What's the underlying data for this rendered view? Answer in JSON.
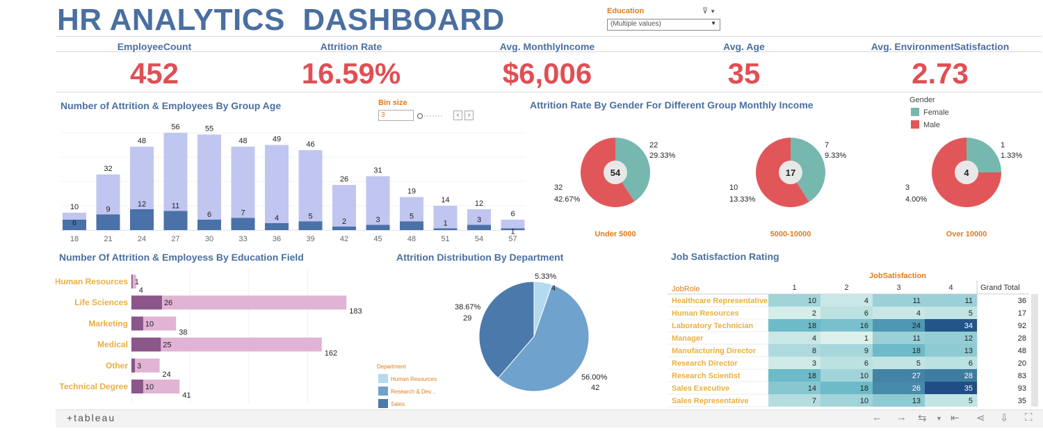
{
  "title": "HR ANALYTICS  DASHBOARD",
  "filter": {
    "label": "Education",
    "value": "(Multiple values)",
    "clear_icon": "filter-clear-icon",
    "dropdown_icon": "chevron-down-icon"
  },
  "kpis": [
    {
      "label": "EmployeeCount",
      "value": "452"
    },
    {
      "label": "Attrition Rate",
      "value": "16.59%"
    },
    {
      "label": "Avg. MonthlyIncome",
      "value": "$6,006"
    },
    {
      "label": "Avg. Age",
      "value": "35"
    },
    {
      "label": "Avg. EnvironmentSatisfaction",
      "value": "2.73"
    }
  ],
  "age_chart": {
    "title": "Number of Attrition & Employees By Group Age",
    "bin_label": "Bin size",
    "bin_value": "3"
  },
  "gender_chart": {
    "title": "Attrition Rate By Gender For Different Group Monthly Income",
    "legend_title": "Gender",
    "legend": [
      "Female",
      "Male"
    ]
  },
  "edu_chart": {
    "title": "Number Of Attrition & Employess By Education Field"
  },
  "dept_chart": {
    "title": "Attrition Distribution By Department",
    "legend_title": "Department",
    "legend": [
      "Human Resources",
      "Research & Dev...",
      "Sales"
    ]
  },
  "job_chart": {
    "title": "Job Satisfaction Rating"
  },
  "colors": {
    "title_blue": "#4a6fa0",
    "kpi_red": "#e04f55",
    "orange": "#e07b1a",
    "bar_light": "#c0c6f0",
    "bar_dark": "#4a71a8",
    "female": "#76b7b0",
    "male": "#e15759",
    "edu_light": "#e1b3d4",
    "edu_dark": "#8b568a",
    "dept_hr": "#b5daf0",
    "dept_rd": "#6fa2cc",
    "dept_sales": "#4b79ab"
  },
  "chart_data": [
    {
      "type": "bar",
      "categories": [
        "18",
        "21",
        "24",
        "27",
        "30",
        "33",
        "36",
        "39",
        "42",
        "45",
        "48",
        "51",
        "54",
        "57"
      ],
      "series": [
        {
          "values": [
            10,
            32,
            48,
            56,
            55,
            48,
            49,
            46,
            26,
            31,
            19,
            14,
            12,
            6
          ]
        },
        {
          "values": [
            6,
            9,
            12,
            11,
            6,
            7,
            4,
            5,
            2,
            3,
            5,
            1,
            3,
            1
          ]
        }
      ]
    },
    {
      "type": "pie",
      "groups": [
        {
          "label": "Under 5000",
          "total": 54,
          "female": {
            "count": 22,
            "pct": "29.33%"
          },
          "male": {
            "count": 32,
            "pct": "42.67%"
          }
        },
        {
          "label": "5000-10000",
          "total": 17,
          "female": {
            "count": 7,
            "pct": "9.33%"
          },
          "male": {
            "count": 10,
            "pct": "13.33%"
          }
        },
        {
          "label": "Over 10000",
          "total": 4,
          "female": {
            "count": 1,
            "pct": "1.33%"
          },
          "male": {
            "count": 3,
            "pct": "4.00%"
          }
        }
      ]
    },
    {
      "type": "bar",
      "categories": [
        "Human Resources",
        "Life Sciences",
        "Marketing",
        "Medical",
        "Other",
        "Technical Degree"
      ],
      "series": [
        {
          "values": [
            4,
            183,
            38,
            162,
            24,
            41
          ]
        },
        {
          "values": [
            1,
            26,
            10,
            25,
            3,
            10
          ]
        }
      ]
    },
    {
      "type": "pie",
      "slices": [
        {
          "label": "Human Resources",
          "count": 4,
          "pct": "5.33%"
        },
        {
          "label": "Research & Dev...",
          "count": 42,
          "pct": "56.00%"
        },
        {
          "label": "Sales",
          "count": 29,
          "pct": "38.67%"
        }
      ]
    },
    {
      "type": "heatmap",
      "column_header": "JobSatisfaction",
      "row_header": "JobRole",
      "columns": [
        "1",
        "2",
        "3",
        "4"
      ],
      "total_label": "Grand Total",
      "rows": [
        {
          "role": "Healthcare Representative",
          "values": [
            10,
            4,
            11,
            11
          ],
          "total": 36
        },
        {
          "role": "Human Resources",
          "values": [
            2,
            6,
            4,
            5
          ],
          "total": 17
        },
        {
          "role": "Laboratory Technician",
          "values": [
            18,
            16,
            24,
            34
          ],
          "total": 92
        },
        {
          "role": "Manager",
          "values": [
            4,
            1,
            11,
            12
          ],
          "total": 28
        },
        {
          "role": "Manufacturing Director",
          "values": [
            8,
            9,
            18,
            13
          ],
          "total": 48
        },
        {
          "role": "Research Director",
          "values": [
            3,
            6,
            5,
            6
          ],
          "total": 20
        },
        {
          "role": "Research Scientist",
          "values": [
            18,
            10,
            27,
            28
          ],
          "total": 83
        },
        {
          "role": "Sales Executive",
          "values": [
            14,
            18,
            26,
            35
          ],
          "total": 93
        },
        {
          "role": "Sales Representative",
          "values": [
            7,
            10,
            13,
            5
          ],
          "total": 35
        }
      ]
    }
  ],
  "toolbar": {
    "logo": "+tableau",
    "icons": [
      "undo-icon",
      "redo-icon",
      "revert-icon",
      "chevron-down-icon",
      "reset-icon",
      "share-icon",
      "download-icon",
      "fullscreen-icon"
    ]
  }
}
